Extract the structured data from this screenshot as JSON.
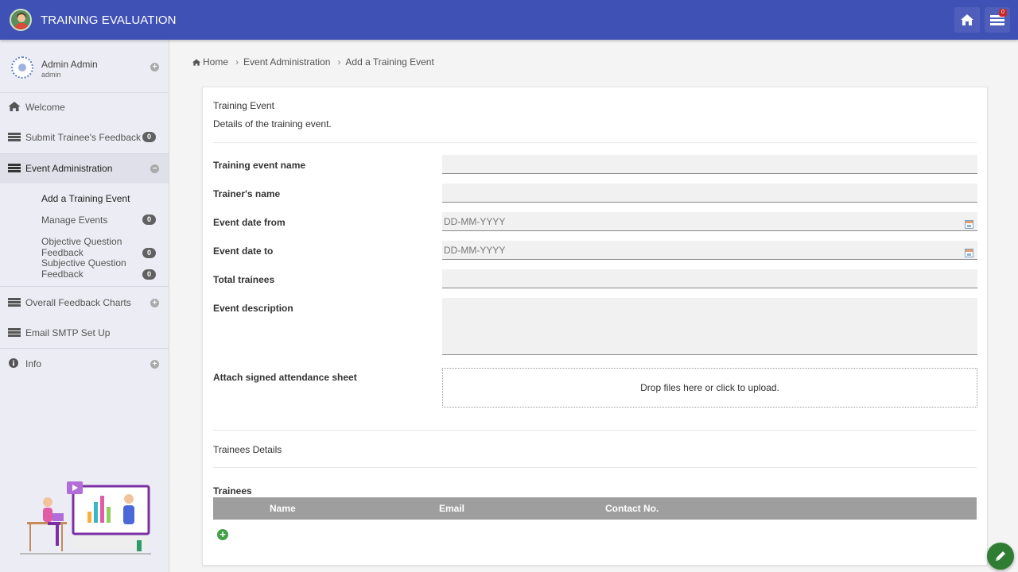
{
  "header": {
    "title": "TRAINING EVALUATION",
    "notification_count": "0"
  },
  "user": {
    "name": "Admin Admin",
    "role": "admin"
  },
  "sidebar": {
    "items": [
      {
        "label": "Welcome",
        "icon": "home-icon"
      },
      {
        "label": "Submit Trainee's Feedback",
        "icon": "list-icon",
        "count": "0"
      },
      {
        "label": "Event Administration",
        "icon": "list-icon",
        "expanded": true
      },
      {
        "label": "Overall Feedback Charts",
        "icon": "list-icon"
      },
      {
        "label": "Email SMTP Set Up",
        "icon": "list-icon"
      },
      {
        "label": "Info",
        "icon": "info-icon"
      }
    ],
    "sub_items": [
      {
        "label": "Add a Training Event",
        "active": true
      },
      {
        "label": "Manage Events",
        "count": "0"
      },
      {
        "label": "Objective Question Feedback",
        "count": "0"
      },
      {
        "label": "Subjective Question Feedback",
        "count": "0"
      }
    ]
  },
  "breadcrumb": [
    "Home",
    "Event Administration",
    "Add a Training Event"
  ],
  "form": {
    "section_title": "Training Event",
    "section_subtitle": "Details of the training event.",
    "fields": [
      {
        "label": "Training event name",
        "value": ""
      },
      {
        "label": "Trainer's name",
        "value": ""
      },
      {
        "label": "Event date from",
        "placeholder": "DD-MM-YYYY"
      },
      {
        "label": "Event date to",
        "placeholder": "DD-MM-YYYY"
      },
      {
        "label": "Total trainees",
        "value": ""
      },
      {
        "label": "Event description",
        "value": ""
      },
      {
        "label": "Attach signed attendance sheet"
      }
    ],
    "dropzone_text": "Drop files here or click to upload.",
    "trainees_section_title": "Trainees Details",
    "trainees_label": "Trainees",
    "table_headers": [
      "Name",
      "Email",
      "Contact No."
    ]
  },
  "colors": {
    "header_bg": "#3f51b5",
    "sidebar_bg": "#ececf5",
    "add_button": "#43a047",
    "fab": "#2e7d32"
  }
}
